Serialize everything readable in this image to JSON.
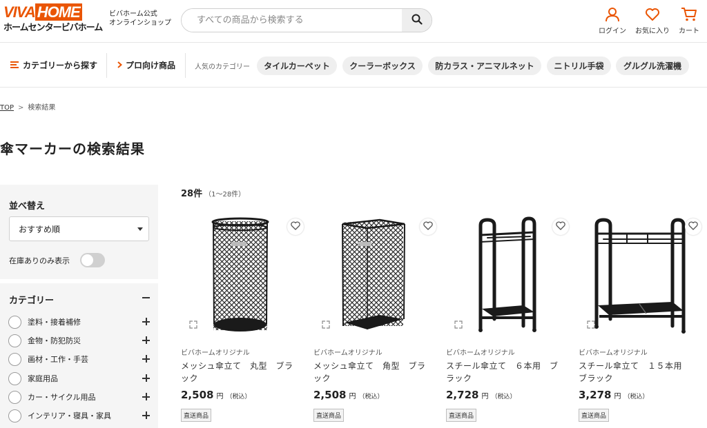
{
  "header": {
    "logo_viva": "VIVA",
    "logo_home": "HOME",
    "logo_sub": "ホームセンタービバホーム",
    "site_name_line1": "ビバホーム公式",
    "site_name_line2": "オンラインショップ",
    "search_placeholder": "すべての商品から検索する",
    "login_label": "ログイン",
    "favorites_label": "お気に入り",
    "cart_label": "カート",
    "accent_color": "#ea5504"
  },
  "nav": {
    "category_label": "カテゴリーから探す",
    "pro_label": "プロ向け商品",
    "popular_label": "人気のカテゴリー",
    "chips": [
      "タイルカーペット",
      "クーラーボックス",
      "防カラス・アニマルネット",
      "ニトリル手袋",
      "グルグル洗濯機"
    ]
  },
  "breadcrumb": {
    "top": "TOP",
    "separator": ">",
    "current": "検索結果"
  },
  "page_title": "傘マーカーの検索結果",
  "sidebar": {
    "sort_label": "並べ替え",
    "sort_value": "おすすめ順",
    "stock_label": "在庫ありのみ表示",
    "stock_only": false,
    "category_heading": "カテゴリー",
    "categories": [
      "塗料・接着補修",
      "金物・防犯防災",
      "画材・工作・手芸",
      "家庭用品",
      "カー・サイクル用品",
      "インテリア・寝具・家具"
    ]
  },
  "results": {
    "count": "28件",
    "range": "（1〜28件）",
    "products": [
      {
        "brand": "ビバホームオリジナル",
        "name": "メッシュ傘立て　丸型　ブラック",
        "price": "2,508",
        "yen": "円",
        "tax": "（税込）",
        "badge": "直送商品",
        "image": "round-mesh-stand"
      },
      {
        "brand": "ビバホームオリジナル",
        "name": "メッシュ傘立て　角型　ブラック",
        "price": "2,508",
        "yen": "円",
        "tax": "（税込）",
        "badge": "直送商品",
        "image": "square-mesh-stand"
      },
      {
        "brand": "ビバホームオリジナル",
        "name": "スチール傘立て　６本用　ブラック",
        "price": "2,728",
        "yen": "円",
        "tax": "（税込）",
        "badge": "直送商品",
        "image": "steel-stand-6"
      },
      {
        "brand": "ビバホームオリジナル",
        "name": "スチール傘立て　１５本用　ブラック",
        "price": "3,278",
        "yen": "円",
        "tax": "（税込）",
        "badge": "直送商品",
        "image": "steel-stand-15"
      }
    ]
  }
}
